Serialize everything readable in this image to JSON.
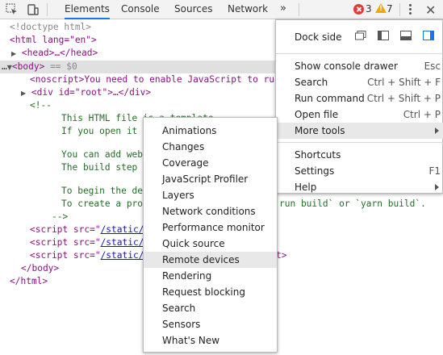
{
  "toolbar": {
    "tabs": [
      "Elements",
      "Console",
      "Sources",
      "Network"
    ],
    "more_tabs": "»",
    "error_count": "3",
    "warning_count": "7",
    "close": "✕"
  },
  "tree": {
    "doctype": "<!doctype html>",
    "html_open": "<html lang=\"en\">",
    "head": "<head>…</head>",
    "body_prefix": "…",
    "body_tag": "<body>",
    "body_suffix": " == $0",
    "noscript": "<noscript>You need to enable JavaScript to run",
    "div_root": "<div id=\"root\">…</div>",
    "comment_open": "<!--",
    "c1": "This HTML file is a template.",
    "c2": "If you open it d",
    "c3": "You can add webf",
    "c4": "The build step w",
    "c5": "To begin the dev",
    "c6a": "To create a prod",
    "c6b": "run build` or `yarn build`.",
    "comment_close": "-->",
    "script1": "<script src=\"",
    "script1_link": "/static/",
    "script2": "<script src=\"",
    "script2_link": "/static/",
    "script3": "<script src=\"",
    "script3_link": "/static/",
    "script3_tail": "t>",
    "body_close": "</body>",
    "html_close": "</html>"
  },
  "main_menu": {
    "dock_side_label": "Dock side",
    "items": [
      {
        "label": "Show console drawer",
        "shortcut": "Esc"
      },
      {
        "label": "Search",
        "shortcut": "Ctrl + Shift + F"
      },
      {
        "label": "Run command",
        "shortcut": "Ctrl + Shift + P"
      },
      {
        "label": "Open file",
        "shortcut": "Ctrl + P"
      },
      {
        "label": "More tools",
        "shortcut": ""
      },
      {
        "label": "Shortcuts",
        "shortcut": ""
      },
      {
        "label": "Settings",
        "shortcut": "F1"
      },
      {
        "label": "Help",
        "shortcut": ""
      }
    ]
  },
  "more_tools": {
    "items": [
      "Animations",
      "Changes",
      "Coverage",
      "JavaScript Profiler",
      "Layers",
      "Network conditions",
      "Performance monitor",
      "Quick source",
      "Remote devices",
      "Rendering",
      "Request blocking",
      "Search",
      "Sensors",
      "What's New"
    ],
    "highlighted": "Remote devices"
  },
  "colors": {
    "tab_underline": "#1a73e8",
    "error": "#e53935",
    "warning": "#f2a600",
    "tag": "#881280",
    "attr": "#994500",
    "comment": "#236e25"
  }
}
